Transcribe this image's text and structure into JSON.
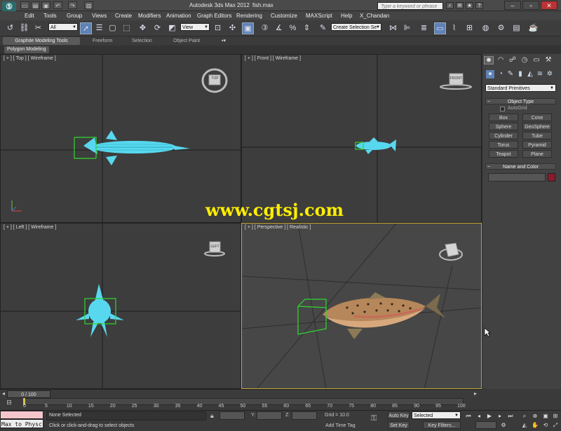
{
  "app": {
    "title": "Autodesk 3ds Max  2012",
    "file": "fish.max",
    "search_placeholder": "Type a keyword or phrase"
  },
  "menu": [
    "Edit",
    "Tools",
    "Group",
    "Views",
    "Create",
    "Modifiers",
    "Animation",
    "Graph Editors",
    "Rendering",
    "Customize",
    "MAXScript",
    "Help",
    "X_Chandan"
  ],
  "toolbar": {
    "filter_value": "All",
    "refcoord_value": "View",
    "selection_set_placeholder": "Create Selection Se"
  },
  "ribbon": {
    "tabs": [
      "Graphite Modeling Tools",
      "Freeform",
      "Selection",
      "Object Paint"
    ],
    "subtab": "Polygon Modeling"
  },
  "viewports": {
    "top": "[ + ] [ Top ] [ Wireframe ]",
    "front": "[ + ] [ Front ] [ Wireframe ]",
    "left": "[ + ] [ Left ] [ Wireframe ]",
    "perspective": "[ + ] [ Perspective ] [ Realistic ]",
    "cube_top": "TOP",
    "cube_front": "FRONT",
    "cube_left": "LEFT"
  },
  "watermark": "www.cgtsj.com",
  "command_panel": {
    "category_value": "Standard Primitives",
    "object_type_title": "Object Type",
    "autogrid_label": "AutoGrid",
    "primitives": [
      "Box",
      "Cone",
      "Sphere",
      "GeoSphere",
      "Cylinder",
      "Tube",
      "Torus",
      "Pyramid",
      "Teapot",
      "Plane"
    ],
    "name_color_title": "Name and Color",
    "object_color": "#8b1a2d"
  },
  "timeline": {
    "frame_display": "0 / 100",
    "ticks": [
      "0",
      "5",
      "10",
      "15",
      "20",
      "25",
      "30",
      "35",
      "40",
      "45",
      "50",
      "55",
      "60",
      "65",
      "70",
      "75",
      "80",
      "85",
      "90",
      "95",
      "100"
    ]
  },
  "status": {
    "maxscript_text": "Max to Physc",
    "selection_text": "None Selected",
    "prompt_text": "Click or click-and-drag to select objects",
    "x_label": "X:",
    "y_label": "Y:",
    "z_label": "Z:",
    "grid_text": "Grid = 10.0",
    "add_time_tag": "Add Time Tag",
    "auto_key": "Auto Key",
    "set_key": "Set Key",
    "selected_value": "Selected",
    "key_filters": "Key Filters..."
  },
  "colors": {
    "fish_wire": "#58d8ef",
    "selection_bracket": "#2fd82f",
    "active_viewport_border": "#c8a83a",
    "watermark": "#ffee00"
  }
}
